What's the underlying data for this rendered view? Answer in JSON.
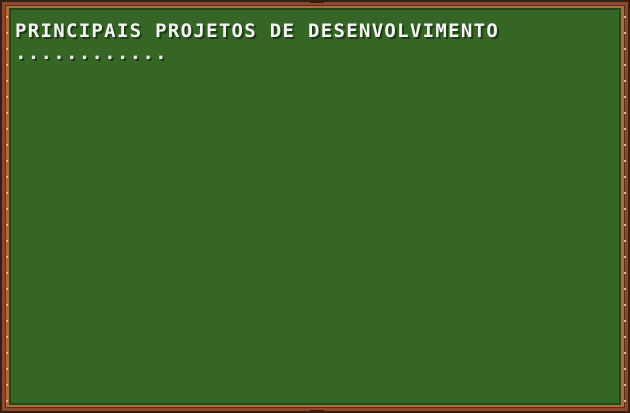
{
  "board": {
    "title": "PRINCIPAIS PROJETOS DE DESENVOLVIMENTO",
    "dots": "............",
    "colors": {
      "chalk": "#356626",
      "frame": "#8a4a2c",
      "text": "#f4f4f4"
    }
  }
}
